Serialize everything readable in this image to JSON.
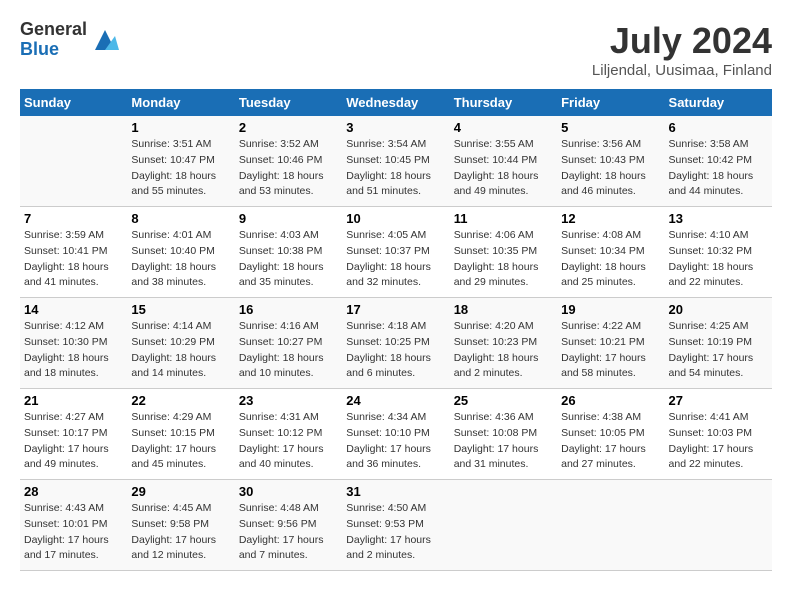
{
  "logo": {
    "general": "General",
    "blue": "Blue"
  },
  "title": "July 2024",
  "location": "Liljendal, Uusimaa, Finland",
  "days_of_week": [
    "Sunday",
    "Monday",
    "Tuesday",
    "Wednesday",
    "Thursday",
    "Friday",
    "Saturday"
  ],
  "weeks": [
    [
      {
        "day": "",
        "info": ""
      },
      {
        "day": "1",
        "info": "Sunrise: 3:51 AM\nSunset: 10:47 PM\nDaylight: 18 hours\nand 55 minutes."
      },
      {
        "day": "2",
        "info": "Sunrise: 3:52 AM\nSunset: 10:46 PM\nDaylight: 18 hours\nand 53 minutes."
      },
      {
        "day": "3",
        "info": "Sunrise: 3:54 AM\nSunset: 10:45 PM\nDaylight: 18 hours\nand 51 minutes."
      },
      {
        "day": "4",
        "info": "Sunrise: 3:55 AM\nSunset: 10:44 PM\nDaylight: 18 hours\nand 49 minutes."
      },
      {
        "day": "5",
        "info": "Sunrise: 3:56 AM\nSunset: 10:43 PM\nDaylight: 18 hours\nand 46 minutes."
      },
      {
        "day": "6",
        "info": "Sunrise: 3:58 AM\nSunset: 10:42 PM\nDaylight: 18 hours\nand 44 minutes."
      }
    ],
    [
      {
        "day": "7",
        "info": "Sunrise: 3:59 AM\nSunset: 10:41 PM\nDaylight: 18 hours\nand 41 minutes."
      },
      {
        "day": "8",
        "info": "Sunrise: 4:01 AM\nSunset: 10:40 PM\nDaylight: 18 hours\nand 38 minutes."
      },
      {
        "day": "9",
        "info": "Sunrise: 4:03 AM\nSunset: 10:38 PM\nDaylight: 18 hours\nand 35 minutes."
      },
      {
        "day": "10",
        "info": "Sunrise: 4:05 AM\nSunset: 10:37 PM\nDaylight: 18 hours\nand 32 minutes."
      },
      {
        "day": "11",
        "info": "Sunrise: 4:06 AM\nSunset: 10:35 PM\nDaylight: 18 hours\nand 29 minutes."
      },
      {
        "day": "12",
        "info": "Sunrise: 4:08 AM\nSunset: 10:34 PM\nDaylight: 18 hours\nand 25 minutes."
      },
      {
        "day": "13",
        "info": "Sunrise: 4:10 AM\nSunset: 10:32 PM\nDaylight: 18 hours\nand 22 minutes."
      }
    ],
    [
      {
        "day": "14",
        "info": "Sunrise: 4:12 AM\nSunset: 10:30 PM\nDaylight: 18 hours\nand 18 minutes."
      },
      {
        "day": "15",
        "info": "Sunrise: 4:14 AM\nSunset: 10:29 PM\nDaylight: 18 hours\nand 14 minutes."
      },
      {
        "day": "16",
        "info": "Sunrise: 4:16 AM\nSunset: 10:27 PM\nDaylight: 18 hours\nand 10 minutes."
      },
      {
        "day": "17",
        "info": "Sunrise: 4:18 AM\nSunset: 10:25 PM\nDaylight: 18 hours\nand 6 minutes."
      },
      {
        "day": "18",
        "info": "Sunrise: 4:20 AM\nSunset: 10:23 PM\nDaylight: 18 hours\nand 2 minutes."
      },
      {
        "day": "19",
        "info": "Sunrise: 4:22 AM\nSunset: 10:21 PM\nDaylight: 17 hours\nand 58 minutes."
      },
      {
        "day": "20",
        "info": "Sunrise: 4:25 AM\nSunset: 10:19 PM\nDaylight: 17 hours\nand 54 minutes."
      }
    ],
    [
      {
        "day": "21",
        "info": "Sunrise: 4:27 AM\nSunset: 10:17 PM\nDaylight: 17 hours\nand 49 minutes."
      },
      {
        "day": "22",
        "info": "Sunrise: 4:29 AM\nSunset: 10:15 PM\nDaylight: 17 hours\nand 45 minutes."
      },
      {
        "day": "23",
        "info": "Sunrise: 4:31 AM\nSunset: 10:12 PM\nDaylight: 17 hours\nand 40 minutes."
      },
      {
        "day": "24",
        "info": "Sunrise: 4:34 AM\nSunset: 10:10 PM\nDaylight: 17 hours\nand 36 minutes."
      },
      {
        "day": "25",
        "info": "Sunrise: 4:36 AM\nSunset: 10:08 PM\nDaylight: 17 hours\nand 31 minutes."
      },
      {
        "day": "26",
        "info": "Sunrise: 4:38 AM\nSunset: 10:05 PM\nDaylight: 17 hours\nand 27 minutes."
      },
      {
        "day": "27",
        "info": "Sunrise: 4:41 AM\nSunset: 10:03 PM\nDaylight: 17 hours\nand 22 minutes."
      }
    ],
    [
      {
        "day": "28",
        "info": "Sunrise: 4:43 AM\nSunset: 10:01 PM\nDaylight: 17 hours\nand 17 minutes."
      },
      {
        "day": "29",
        "info": "Sunrise: 4:45 AM\nSunset: 9:58 PM\nDaylight: 17 hours\nand 12 minutes."
      },
      {
        "day": "30",
        "info": "Sunrise: 4:48 AM\nSunset: 9:56 PM\nDaylight: 17 hours\nand 7 minutes."
      },
      {
        "day": "31",
        "info": "Sunrise: 4:50 AM\nSunset: 9:53 PM\nDaylight: 17 hours\nand 2 minutes."
      },
      {
        "day": "",
        "info": ""
      },
      {
        "day": "",
        "info": ""
      },
      {
        "day": "",
        "info": ""
      }
    ]
  ]
}
